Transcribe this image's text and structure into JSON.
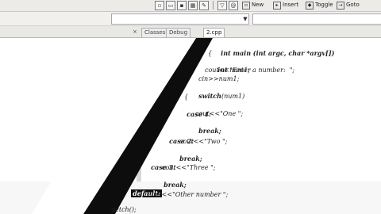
{
  "toolbar": {
    "icons": [
      "new-file-icon",
      "open-icon",
      "save-icon",
      "save-all-icon",
      "edit-icon",
      "filter-icon",
      "at-icon"
    ],
    "buttons": [
      {
        "label": "New",
        "icon": "new-icon"
      },
      {
        "label": "Insert",
        "icon": "insert-icon"
      },
      {
        "label": "Toggle",
        "icon": "toggle-icon"
      },
      {
        "label": "Goto",
        "icon": "goto-icon"
      }
    ]
  },
  "tabs": [
    {
      "label": "Classes"
    },
    {
      "label": "Debug"
    },
    {
      "label": "2.cpp"
    }
  ],
  "code": {
    "line1": "int main (int argc, char *argv[])",
    "line2": "{",
    "line3_kw": "int",
    "line3_rest": " num1;",
    "line4": "cout<<\"Enter a number:  \";",
    "line5": "cin>>num1;",
    "line6_kw": "switch",
    "line6_rest": "(num1)",
    "line7": "{",
    "case1_kw": "case",
    "case1_rest": " 1:",
    "cout1": "cout<<\"One \";",
    "break1": "break;",
    "case2_kw": "case",
    "case2_rest": " 2:",
    "cout2": "cout<<\"Two \";",
    "break2": "break;",
    "case3_kw": "case",
    "case3_rest": " 3:",
    "cout3": "cout<<\"Three \";",
    "break3": "break;",
    "default_kw": "default:",
    "cout_default": "cout<<\"Other number \";",
    "getch": "getch();"
  }
}
